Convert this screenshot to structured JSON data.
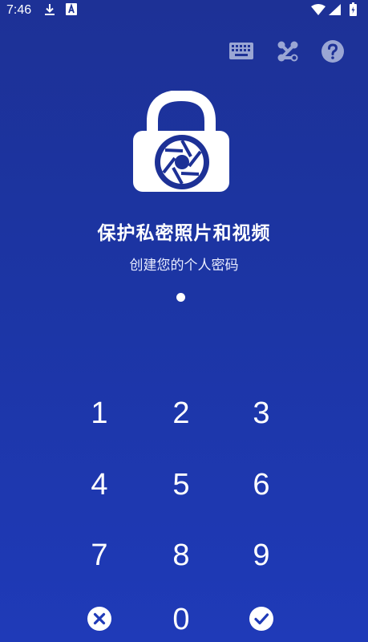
{
  "status_bar": {
    "time": "7:46",
    "icons": [
      "download-icon",
      "app-notification-icon",
      "wifi-icon",
      "signal-icon",
      "battery-icon"
    ]
  },
  "toolbar": {
    "icons": [
      "keyboard-icon",
      "pattern-icon",
      "help-icon"
    ]
  },
  "header": {
    "title": "保护私密照片和视频",
    "subtitle": "创建您的个人密码"
  },
  "pin": {
    "entered_count": 1
  },
  "keypad": {
    "keys": [
      "1",
      "2",
      "3",
      "4",
      "5",
      "6",
      "7",
      "8",
      "9"
    ],
    "zero": "0",
    "clear_icon": "clear-icon",
    "confirm_icon": "confirm-icon"
  },
  "colors": {
    "background_top": "#1d3196",
    "background_bottom": "#1f3ab8",
    "toolbar_icon": "#9aa6d4",
    "text": "#ffffff"
  }
}
